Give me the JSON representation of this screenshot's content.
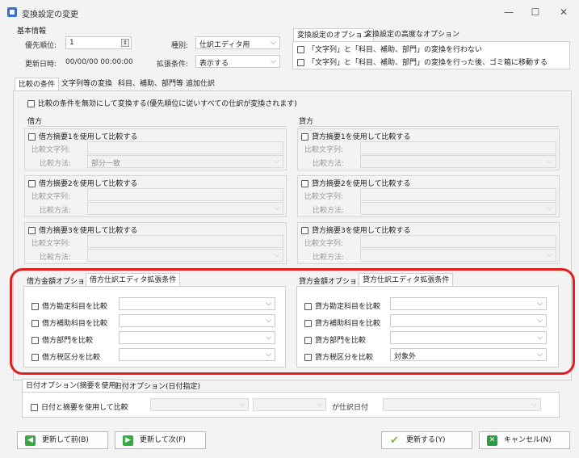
{
  "window": {
    "title": "変換設定の変更",
    "minimize": "—",
    "maximize": "☐",
    "close": "✕"
  },
  "basic": {
    "group_label": "基本情報",
    "priority_label": "優先順位:",
    "priority_value": "1",
    "updated_label": "更新日時:",
    "updated_value": "00/00/00 00:00:00",
    "type_label": "種別:",
    "type_value": "仕訳エディタ用",
    "ext_label": "拡張条件:",
    "ext_value": "表示する"
  },
  "options": {
    "tabs": [
      "変換設定のオプション",
      "変換設定の高度なオプション"
    ],
    "items": [
      "「文字列」と「科目、補助、部門」の変換を行わない",
      "「文字列」と「科目、補助、部門」の変換を行った後、ゴミ箱に移動する"
    ]
  },
  "main_tabs": [
    "比較の条件",
    "文字列等の変換",
    "科目、補助、部門等",
    "追加仕訳"
  ],
  "disable_compare": "比較の条件を無効にして変換する(優先順位に従いすべての仕訳が変換されます)",
  "debit": {
    "header": "借方",
    "blocks": [
      {
        "check": "借方摘要1を使用して比較する",
        "str_label": "比較文字列:",
        "method_label": "比較方法:",
        "method_value": "部分一致"
      },
      {
        "check": "借方摘要2を使用して比較する",
        "str_label": "比較文字列:",
        "method_label": "比較方法:",
        "method_value": ""
      },
      {
        "check": "借方摘要3を使用して比較する",
        "str_label": "比較文字列:",
        "method_label": "比較方法:",
        "method_value": ""
      }
    ],
    "tabs": [
      "借方金額オプション",
      "借方仕訳エディタ拡張条件"
    ],
    "rows": [
      {
        "label": "借方勘定科目を比較",
        "value": ""
      },
      {
        "label": "借方補助科目を比較",
        "value": ""
      },
      {
        "label": "借方部門を比較",
        "value": ""
      },
      {
        "label": "借方税区分を比較",
        "value": ""
      }
    ]
  },
  "credit": {
    "header": "貸方",
    "blocks": [
      {
        "check": "貸方摘要1を使用して比較する",
        "str_label": "比較文字列:",
        "method_label": "比較方法:",
        "method_value": ""
      },
      {
        "check": "貸方摘要2を使用して比較する",
        "str_label": "比較文字列:",
        "method_label": "比較方法:",
        "method_value": ""
      },
      {
        "check": "貸方摘要3を使用して比較する",
        "str_label": "比較文字列:",
        "method_label": "比較方法:",
        "method_value": ""
      }
    ],
    "tabs": [
      "貸方金額オプション",
      "貸方仕訳エディタ拡張条件"
    ],
    "rows": [
      {
        "label": "貸方勘定科目を比較",
        "value": ""
      },
      {
        "label": "貸方補助科目を比較",
        "value": ""
      },
      {
        "label": "貸方部門を比較",
        "value": ""
      },
      {
        "label": "貸方税区分を比較",
        "value": "対象外"
      }
    ]
  },
  "date": {
    "tabs": [
      "日付オプション(摘要を使用)",
      "日付オプション(日付指定)"
    ],
    "check": "日付と摘要を使用して比較",
    "suffix": "が仕訳日付"
  },
  "buttons": {
    "prev": "更新して前(B)",
    "next": "更新して次(F)",
    "update": "更新する(Y)",
    "cancel": "キャンセル(N)"
  },
  "colors": {
    "highlight": "#e01f1f",
    "green_icon": "#3aa845",
    "update_check": "#7bbf2a",
    "cancel_x": "#2e9c3f"
  }
}
